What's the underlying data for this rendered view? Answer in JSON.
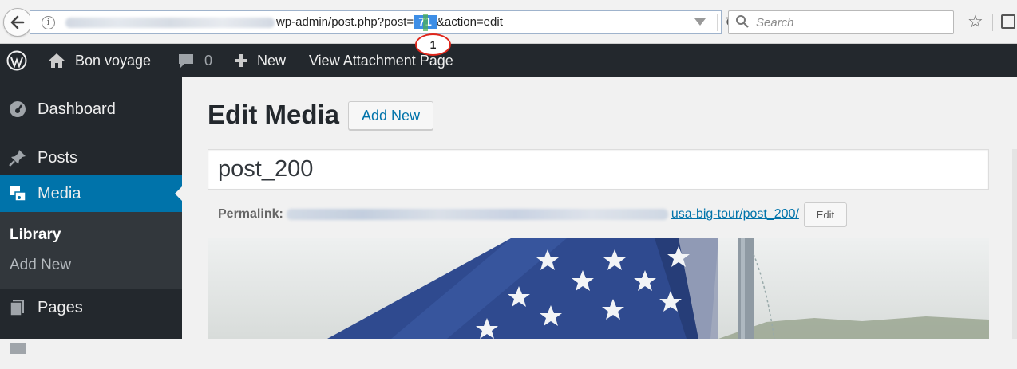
{
  "browser": {
    "url_visible": "wp-admin/post.php?post=",
    "url_selected": "71",
    "url_tail": "&action=edit",
    "search_placeholder": "Search",
    "callout_number": "1"
  },
  "adminbar": {
    "site_name": "Bon voyage",
    "comments_count": "0",
    "new_label": "New",
    "view_label": "View Attachment Page"
  },
  "sidebar": {
    "items": [
      {
        "label": "Dashboard"
      },
      {
        "label": "Posts"
      },
      {
        "label": "Media"
      },
      {
        "label": "Pages"
      }
    ],
    "submenu": {
      "library": "Library",
      "add_new": "Add New"
    }
  },
  "main": {
    "title": "Edit Media",
    "add_new_label": "Add New",
    "post_title": "post_200",
    "permalink_label": "Permalink:",
    "permalink_link": "usa-big-tour/post_200/",
    "edit_label": "Edit"
  },
  "colors": {
    "admin_bg": "#23282d",
    "active_menu": "#0073aa",
    "link": "#0073aa",
    "callout_border": "#e0261b"
  }
}
